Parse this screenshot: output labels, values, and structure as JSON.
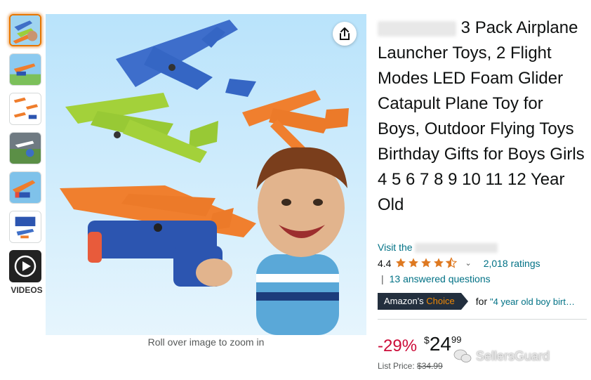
{
  "gallery": {
    "thumbnails": [
      {
        "label": "thumbnail-1"
      },
      {
        "label": "thumbnail-2"
      },
      {
        "label": "thumbnail-3"
      },
      {
        "label": "thumbnail-4"
      },
      {
        "label": "thumbnail-5"
      },
      {
        "label": "thumbnail-6"
      }
    ],
    "videos_label": "VIDEOS",
    "zoom_hint": "Roll over image to zoom in"
  },
  "product": {
    "title": "3 Pack Airplane Launcher Toys, 2 Flight Modes LED Foam Glider Catapult Plane Toy for Boys, Outdoor Flying Toys Birthday Gifts for Boys Girls 4 5 6 7 8 9 10 11 12 Year Old",
    "store_prefix": "Visit the",
    "rating": "4.4",
    "stars": 4.4,
    "ratings_count": "2,018 ratings",
    "answered_questions": "13 answered questions",
    "choice_badge_prefix": "Amazon's",
    "choice_badge_suffix": "Choice",
    "choice_for": "for",
    "choice_keyword": "\"4 year old boy birt…",
    "discount": "-29%",
    "price_symbol": "$",
    "price_whole": "24",
    "price_fraction": "99",
    "list_price_label": "List Price:",
    "list_price": "$34.99"
  },
  "watermark": {
    "text": "SellersGuard"
  },
  "colors": {
    "link": "#007185",
    "discount": "#cc0c39",
    "star": "#de7921",
    "badge": "#232f3e",
    "badge_accent": "#f08804"
  }
}
